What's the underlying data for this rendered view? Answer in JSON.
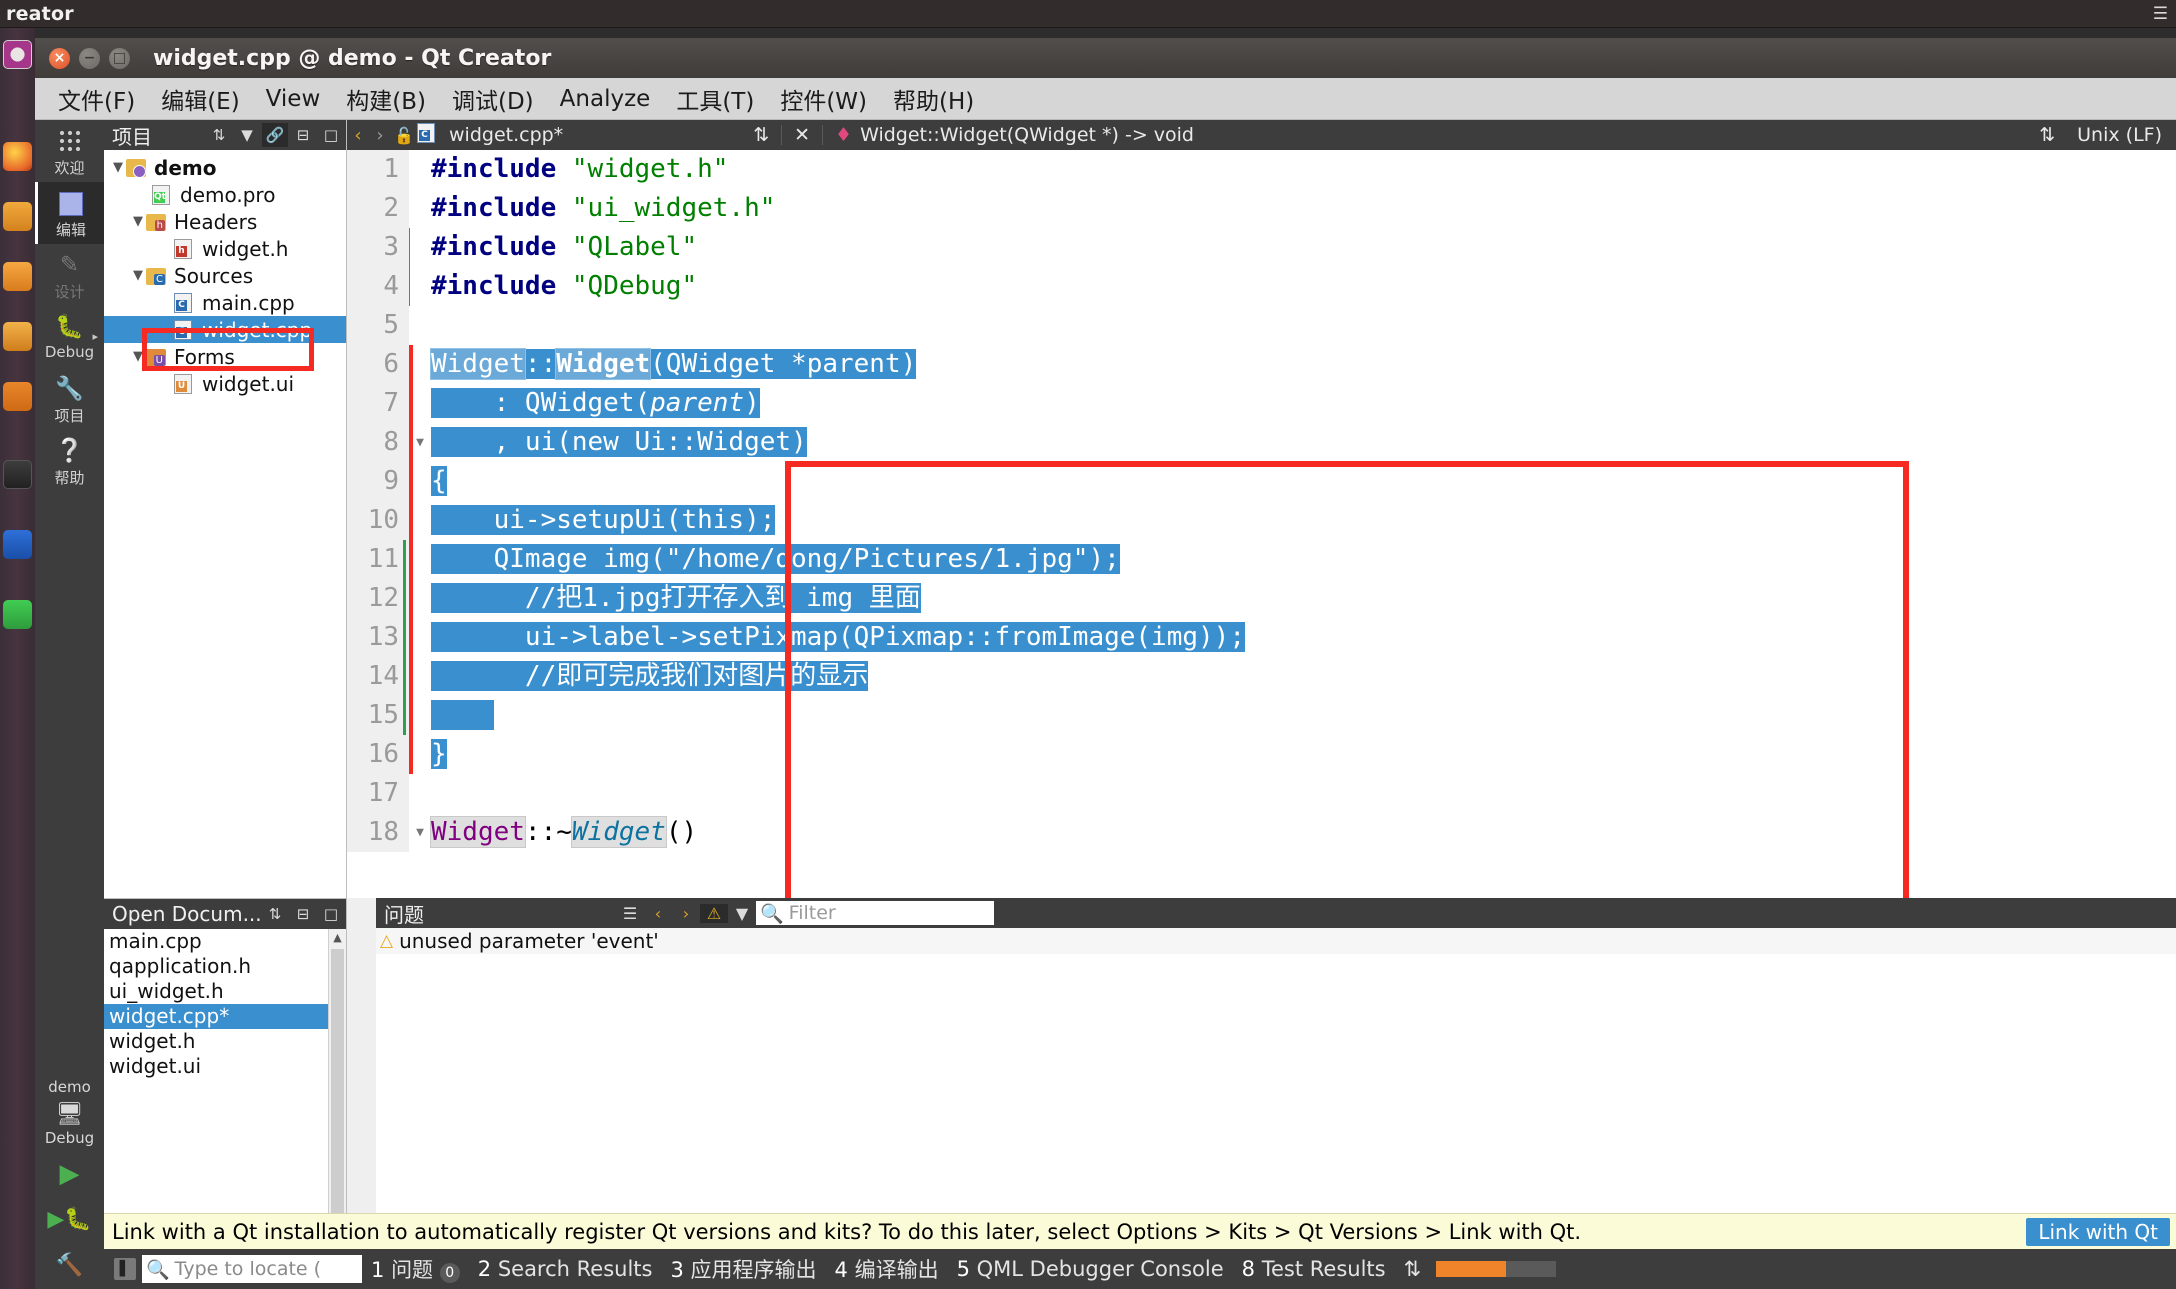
{
  "desktop": {
    "panel_title": "reator",
    "panel_menu_icon": "hamburger-icon",
    "launcher_items": [
      "ubuntu-dash",
      "firefox",
      "files",
      "software-center",
      "amazon",
      "help",
      "text-editor",
      "terminal",
      "qt-creator"
    ]
  },
  "window": {
    "title": "widget.cpp @ demo - Qt Creator",
    "buttons": {
      "close": "×",
      "minimize": "−",
      "maximize": "□"
    }
  },
  "menubar": [
    {
      "label": "文件(F)",
      "mnemonic": "F"
    },
    {
      "label": "编辑(E)",
      "mnemonic": "E"
    },
    {
      "label": "View",
      "mnemonic": "V"
    },
    {
      "label": "构建(B)",
      "mnemonic": "B"
    },
    {
      "label": "调试(D)",
      "mnemonic": "D"
    },
    {
      "label": "Analyze",
      "mnemonic": "A"
    },
    {
      "label": "工具(T)",
      "mnemonic": "T"
    },
    {
      "label": "控件(W)",
      "mnemonic": "W"
    },
    {
      "label": "帮助(H)",
      "mnemonic": "H"
    }
  ],
  "modebar": {
    "items": [
      {
        "label": "欢迎",
        "icon": "grid-icon",
        "state": "normal"
      },
      {
        "label": "编辑",
        "icon": "document-icon",
        "state": "selected"
      },
      {
        "label": "设计",
        "icon": "pencil-icon",
        "state": "disabled"
      },
      {
        "label": "Debug",
        "icon": "bug-icon",
        "state": "normal"
      },
      {
        "label": "项目",
        "icon": "wrench-icon",
        "state": "normal"
      },
      {
        "label": "帮助",
        "icon": "question-icon",
        "state": "normal"
      }
    ],
    "kit": {
      "project": "demo",
      "icon": "desktop-icon",
      "build_config": "Debug"
    },
    "run_buttons": [
      {
        "name": "run-button",
        "glyph": "▶",
        "color": "#4caf50"
      },
      {
        "name": "debug-button",
        "glyph": "▶",
        "color": "#4caf50"
      },
      {
        "name": "build-button",
        "glyph": "🔨",
        "color": "#d8d8d8"
      }
    ]
  },
  "projects_dock": {
    "title": "项目",
    "header_buttons": [
      "sort-icon",
      "filter-icon",
      "link-icon",
      "split-icon",
      "close-icon"
    ],
    "tree": [
      {
        "label": "demo",
        "indent": 0,
        "icon": "project-icon",
        "expanded": true,
        "bold": true
      },
      {
        "label": "demo.pro",
        "indent": 2,
        "icon": "qt-file-icon",
        "expanded": null
      },
      {
        "label": "Headers",
        "indent": 1,
        "icon": "header-folder-icon",
        "expanded": true
      },
      {
        "label": "widget.h",
        "indent": 3,
        "icon": "h-file-icon",
        "expanded": null
      },
      {
        "label": "Sources",
        "indent": 1,
        "icon": "source-folder-icon",
        "expanded": true
      },
      {
        "label": "main.cpp",
        "indent": 3,
        "icon": "cpp-file-icon",
        "expanded": null
      },
      {
        "label": "widget.cpp",
        "indent": 3,
        "icon": "cpp-file-icon",
        "expanded": null,
        "selected": true,
        "highlighted": true
      },
      {
        "label": "Forms",
        "indent": 1,
        "icon": "forms-folder-icon",
        "expanded": true
      },
      {
        "label": "widget.ui",
        "indent": 3,
        "icon": "ui-file-icon",
        "expanded": null
      }
    ]
  },
  "open_documents": {
    "title": "Open Docum...",
    "header_buttons": [
      "sort-icon",
      "split-icon",
      "close-icon"
    ],
    "items": [
      {
        "label": "main.cpp"
      },
      {
        "label": "qapplication.h"
      },
      {
        "label": "ui_widget.h"
      },
      {
        "label": "widget.cpp*",
        "selected": true
      },
      {
        "label": "widget.h"
      },
      {
        "label": "widget.ui"
      }
    ]
  },
  "editor": {
    "tab": {
      "label": "widget.cpp*",
      "lock_icon": "unlocked-icon"
    },
    "nav_back": "‹",
    "nav_forward": "›",
    "symbol": "Widget::Widget(QWidget *) -> void",
    "symbol_marker": "♦",
    "symbol_close": "✕",
    "symbol_updown": "⇅",
    "line_ending": "Unix (LF)",
    "line_ending_updown": "⇅",
    "lines": [
      {
        "n": "1",
        "segments": [
          {
            "t": "#include ",
            "c": "kw"
          },
          {
            "t": "\"widget.h\"",
            "c": "str"
          }
        ]
      },
      {
        "n": "2",
        "segments": [
          {
            "t": "#include ",
            "c": "kw"
          },
          {
            "t": "\"ui_widget.h\"",
            "c": "str"
          }
        ]
      },
      {
        "n": "3",
        "mark": "green",
        "segments": [
          {
            "t": "#include ",
            "c": "kw"
          },
          {
            "t": "\"QLabel\"",
            "c": "str"
          }
        ]
      },
      {
        "n": "4",
        "mark": "green",
        "segments": [
          {
            "t": "#include ",
            "c": "kw"
          },
          {
            "t": "\"QDebug\"",
            "c": "str"
          }
        ]
      },
      {
        "n": "5",
        "segments": []
      },
      {
        "n": "6",
        "mark": "red",
        "sel": true,
        "segments": [
          {
            "t": "Widget",
            "c": "occ"
          },
          {
            "t": "::"
          },
          {
            "t": "Widget",
            "c": "occ bold"
          },
          {
            "t": "(QWidget *parent)"
          }
        ]
      },
      {
        "n": "7",
        "mark": "red",
        "sel": true,
        "segments": [
          {
            "t": "    : QWidget("
          },
          {
            "t": "parent",
            "c": "it"
          },
          {
            "t": ")"
          }
        ]
      },
      {
        "n": "8",
        "mark": "red",
        "sel": true,
        "fold": true,
        "segments": [
          {
            "t": "    , ui(new Ui::Widget)"
          }
        ]
      },
      {
        "n": "9",
        "mark": "red",
        "sel": true,
        "segments": [
          {
            "t": "{"
          }
        ]
      },
      {
        "n": "10",
        "mark": "red",
        "sel": true,
        "segments": [
          {
            "t": "    ui->setupUi(this);"
          }
        ]
      },
      {
        "n": "11",
        "mark": "red-green",
        "sel": true,
        "segments": [
          {
            "t": "    QImage img(\"/home/dong/Pictures/1.jpg\");"
          }
        ]
      },
      {
        "n": "12",
        "mark": "red-green",
        "sel": true,
        "segments": [
          {
            "t": "      //把1.jpg打开存入到 img 里面"
          }
        ]
      },
      {
        "n": "13",
        "mark": "red-green",
        "sel": true,
        "segments": [
          {
            "t": "      ui->label->setPixmap(QPixmap::fromImage(img));"
          }
        ]
      },
      {
        "n": "14",
        "mark": "red-green",
        "sel": true,
        "segments": [
          {
            "t": "      //即可完成我们对图片的显示"
          }
        ]
      },
      {
        "n": "15",
        "mark": "red-green",
        "sel": true,
        "segments": [
          {
            "t": "    "
          }
        ]
      },
      {
        "n": "16",
        "mark": "red",
        "sel": true,
        "segments": [
          {
            "t": "}"
          }
        ]
      },
      {
        "n": "17",
        "segments": []
      },
      {
        "n": "18",
        "fold": true,
        "segments": [
          {
            "t": "Widget",
            "c": "type occ"
          },
          {
            "t": "::~"
          },
          {
            "t": "Widget",
            "c": "cls occ"
          },
          {
            "t": "()"
          }
        ]
      }
    ]
  },
  "issues_pane": {
    "title": "问题",
    "header_buttons": [
      "expand-icon",
      "prev-issue-icon",
      "next-issue-icon",
      "warning-filter-icon",
      "filter-icon"
    ],
    "filter_placeholder": "Filter",
    "filter_icon": "search-icon",
    "rows": [
      {
        "severity": "warning",
        "text": "unused parameter 'event'"
      }
    ]
  },
  "banner": {
    "message": "Link with a Qt installation to automatically register Qt versions and kits? To do this later, select Options > Kits > Qt Versions > Link with Qt.",
    "button": "Link with Qt"
  },
  "statusbar": {
    "toggle_sidebar_icon": "sidebar-icon",
    "locate_placeholder": "Type to locate (",
    "items": [
      {
        "num": "1",
        "label": "问题",
        "badge": "0"
      },
      {
        "num": "2",
        "label": "Search Results"
      },
      {
        "num": "3",
        "label": "应用程序输出"
      },
      {
        "num": "4",
        "label": "编译输出"
      },
      {
        "num": "5",
        "label": "QML Debugger Console"
      },
      {
        "num": "8",
        "label": "Test Results"
      }
    ],
    "updown": "⇅"
  }
}
